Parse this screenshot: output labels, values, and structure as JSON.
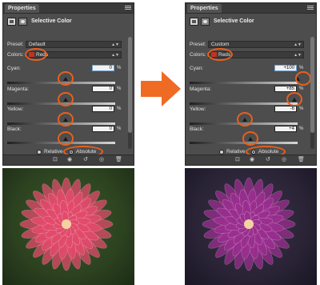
{
  "colors": {
    "panel_bg": "#4d4d4d",
    "highlight": "#e8601e",
    "arrow": "#ef6a23",
    "reds_swatch": "#c23224",
    "dahlia_pink": "#e24a6b",
    "dahlia_purple": "#9a2e8f"
  },
  "icons": [
    "adjustment-layer-icon",
    "layer-mask-icon",
    "panel-menu-icon",
    "clip-to-layer-icon",
    "view-previous-icon",
    "reset-icon",
    "visibility-eye-icon",
    "trash-icon"
  ],
  "before": {
    "tab": "Properties",
    "header": "Selective Color",
    "preset_label": "Preset:",
    "preset_value": "Default",
    "colors_label": "Colors:",
    "colors_value": "Reds",
    "sliders": [
      {
        "label": "Cyan:",
        "value": "0",
        "unit": "%"
      },
      {
        "label": "Magenta:",
        "value": "0",
        "unit": "%"
      },
      {
        "label": "Yellow:",
        "value": "0",
        "unit": "%"
      },
      {
        "label": "Black:",
        "value": "0",
        "unit": "%"
      }
    ],
    "method_relative": "Relative",
    "method_absolute": "Absolute",
    "selected_method": "Absolute"
  },
  "after": {
    "tab": "Properties",
    "header": "Selective Color",
    "preset_label": "Preset:",
    "preset_value": "Custom",
    "colors_label": "Colors:",
    "colors_value": "Reds",
    "sliders": [
      {
        "label": "Cyan:",
        "value": "+100",
        "unit": "%"
      },
      {
        "label": "Magenta:",
        "value": "+85",
        "unit": "%"
      },
      {
        "label": "Yellow:",
        "value": "-6",
        "unit": "%"
      },
      {
        "label": "Black:",
        "value": "+4",
        "unit": "%"
      }
    ],
    "method_relative": "Relative",
    "method_absolute": "Absolute",
    "selected_method": "Absolute"
  }
}
